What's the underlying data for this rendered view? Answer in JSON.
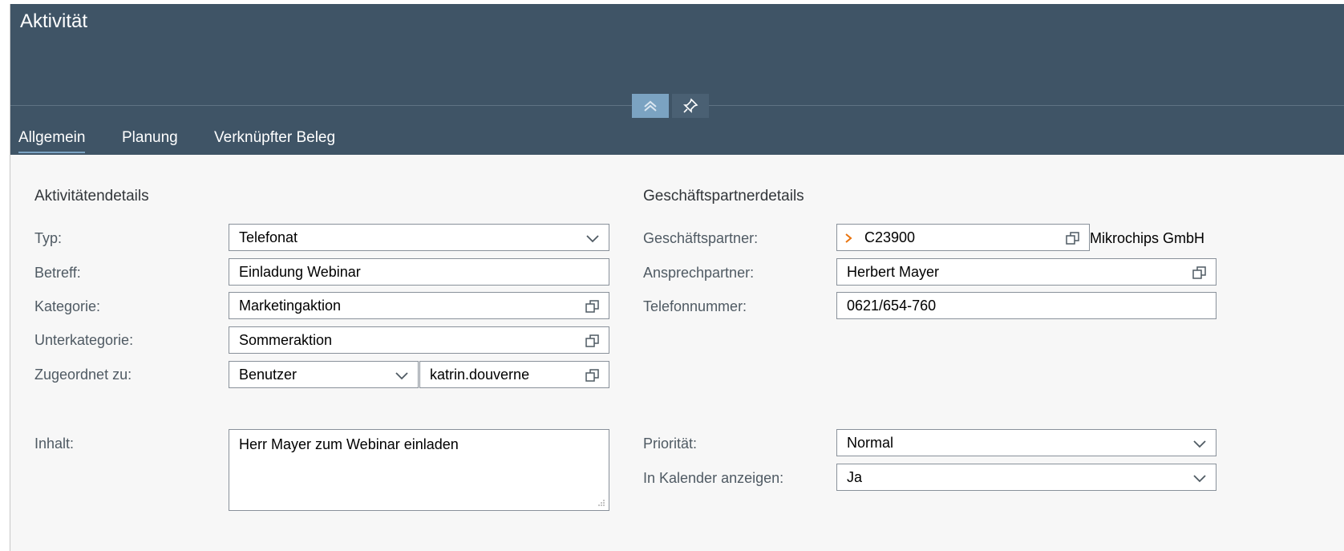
{
  "header": {
    "title": "Aktivität"
  },
  "tabs": [
    {
      "label": "Allgemein",
      "active": true
    },
    {
      "label": "Planung",
      "active": false
    },
    {
      "label": "Verknüpfter Beleg",
      "active": false
    }
  ],
  "activity_details": {
    "title": "Aktivitätendetails",
    "typ": {
      "label": "Typ:",
      "value": "Telefonat"
    },
    "betreff": {
      "label": "Betreff:",
      "value": "Einladung Webinar"
    },
    "kategorie": {
      "label": "Kategorie:",
      "value": "Marketingaktion"
    },
    "unterkategorie": {
      "label": "Unterkategorie:",
      "value": "Sommeraktion"
    },
    "zugeordnet": {
      "label": "Zugeordnet zu:",
      "type_value": "Benutzer",
      "user_value": "katrin.douverne"
    },
    "inhalt": {
      "label": "Inhalt:",
      "value": "Herr Mayer zum Webinar einladen"
    }
  },
  "partner_details": {
    "title": "Geschäftspartnerdetails",
    "geschaeftspartner": {
      "label": "Geschäftspartner:",
      "value": "C23900",
      "name": "Mikrochips GmbH"
    },
    "ansprechpartner": {
      "label": "Ansprechpartner:",
      "value": "Herbert Mayer"
    },
    "telefon": {
      "label": "Telefonnummer:",
      "value": "0621/654-760"
    },
    "prioritaet": {
      "label": "Priorität:",
      "value": "Normal"
    },
    "kalender": {
      "label": "In Kalender anzeigen:",
      "value": "Ja"
    }
  },
  "colors": {
    "header": "#3f5466",
    "accent": "#7ba3c2",
    "link_arrow": "#e9730c"
  },
  "icons": {
    "collapse": "double-chevron-up-icon",
    "pin": "pin-icon",
    "dropdown": "chevron-down-icon",
    "value_help": "value-help-icon",
    "resize": "resize-grip-icon"
  }
}
